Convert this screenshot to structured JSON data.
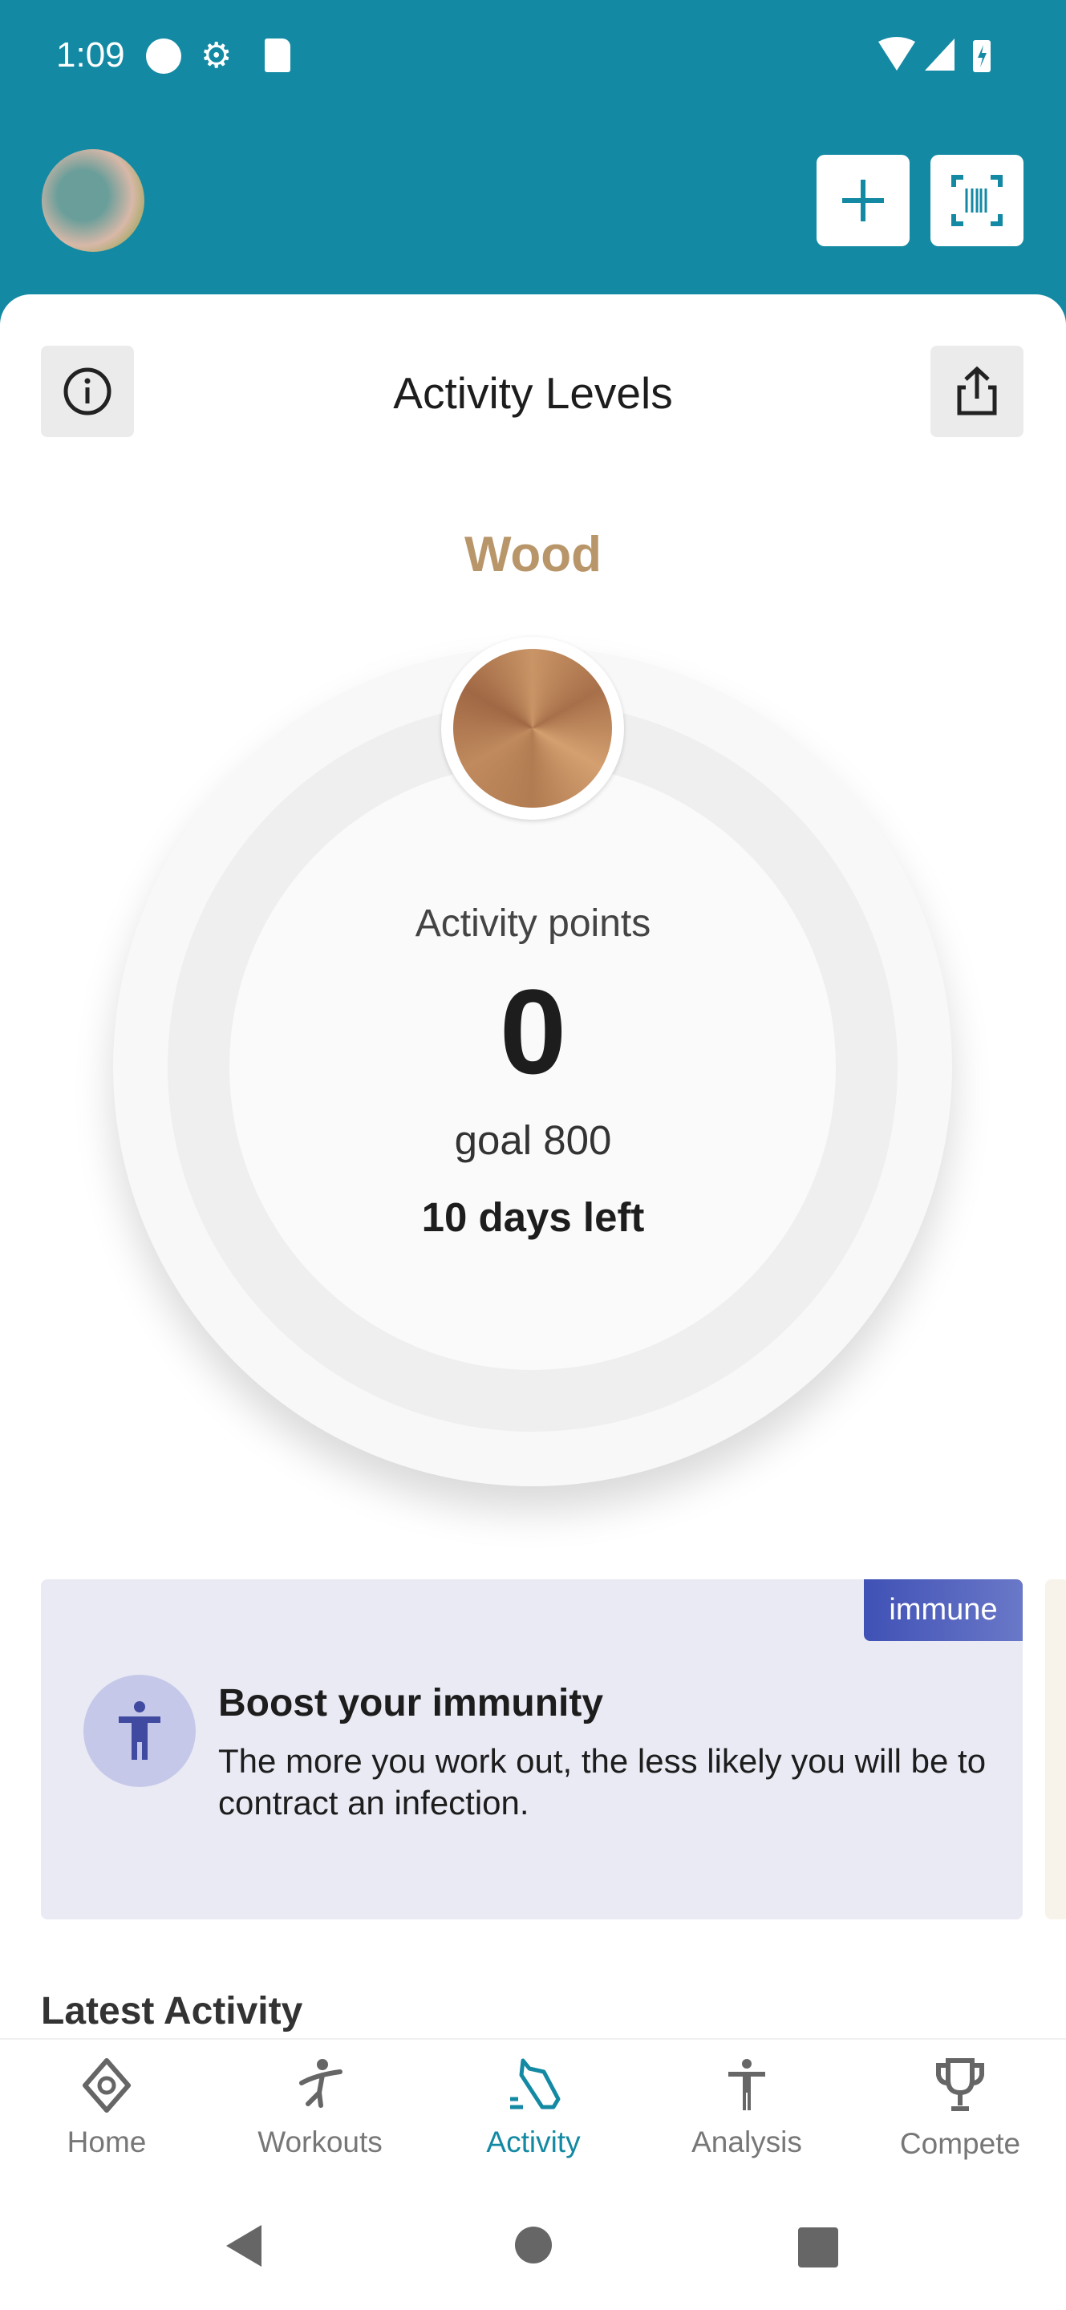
{
  "status_bar": {
    "time": "1:09"
  },
  "header": {
    "add_icon": "plus-icon",
    "scan_icon": "barcode-scan-icon"
  },
  "page": {
    "title": "Activity Levels"
  },
  "level": {
    "name": "Wood",
    "color": "#b8966a"
  },
  "progress": {
    "label": "Activity points",
    "points": "0",
    "goal": "goal 800",
    "days_left": "10 days left",
    "fraction": 0
  },
  "card": {
    "badge": "immune",
    "title": "Boost your immunity",
    "description": "The more you work out, the less likely you will be to contract an infection."
  },
  "latest": {
    "title": "Latest Activity"
  },
  "nav": {
    "items": [
      {
        "label": "Home"
      },
      {
        "label": "Workouts"
      },
      {
        "label": "Activity"
      },
      {
        "label": "Analysis"
      },
      {
        "label": "Compete"
      }
    ],
    "active": "Activity"
  },
  "colors": {
    "primary": "#1389a3",
    "card_bg": "#eaeaf5",
    "badge": "#3f51b5"
  }
}
